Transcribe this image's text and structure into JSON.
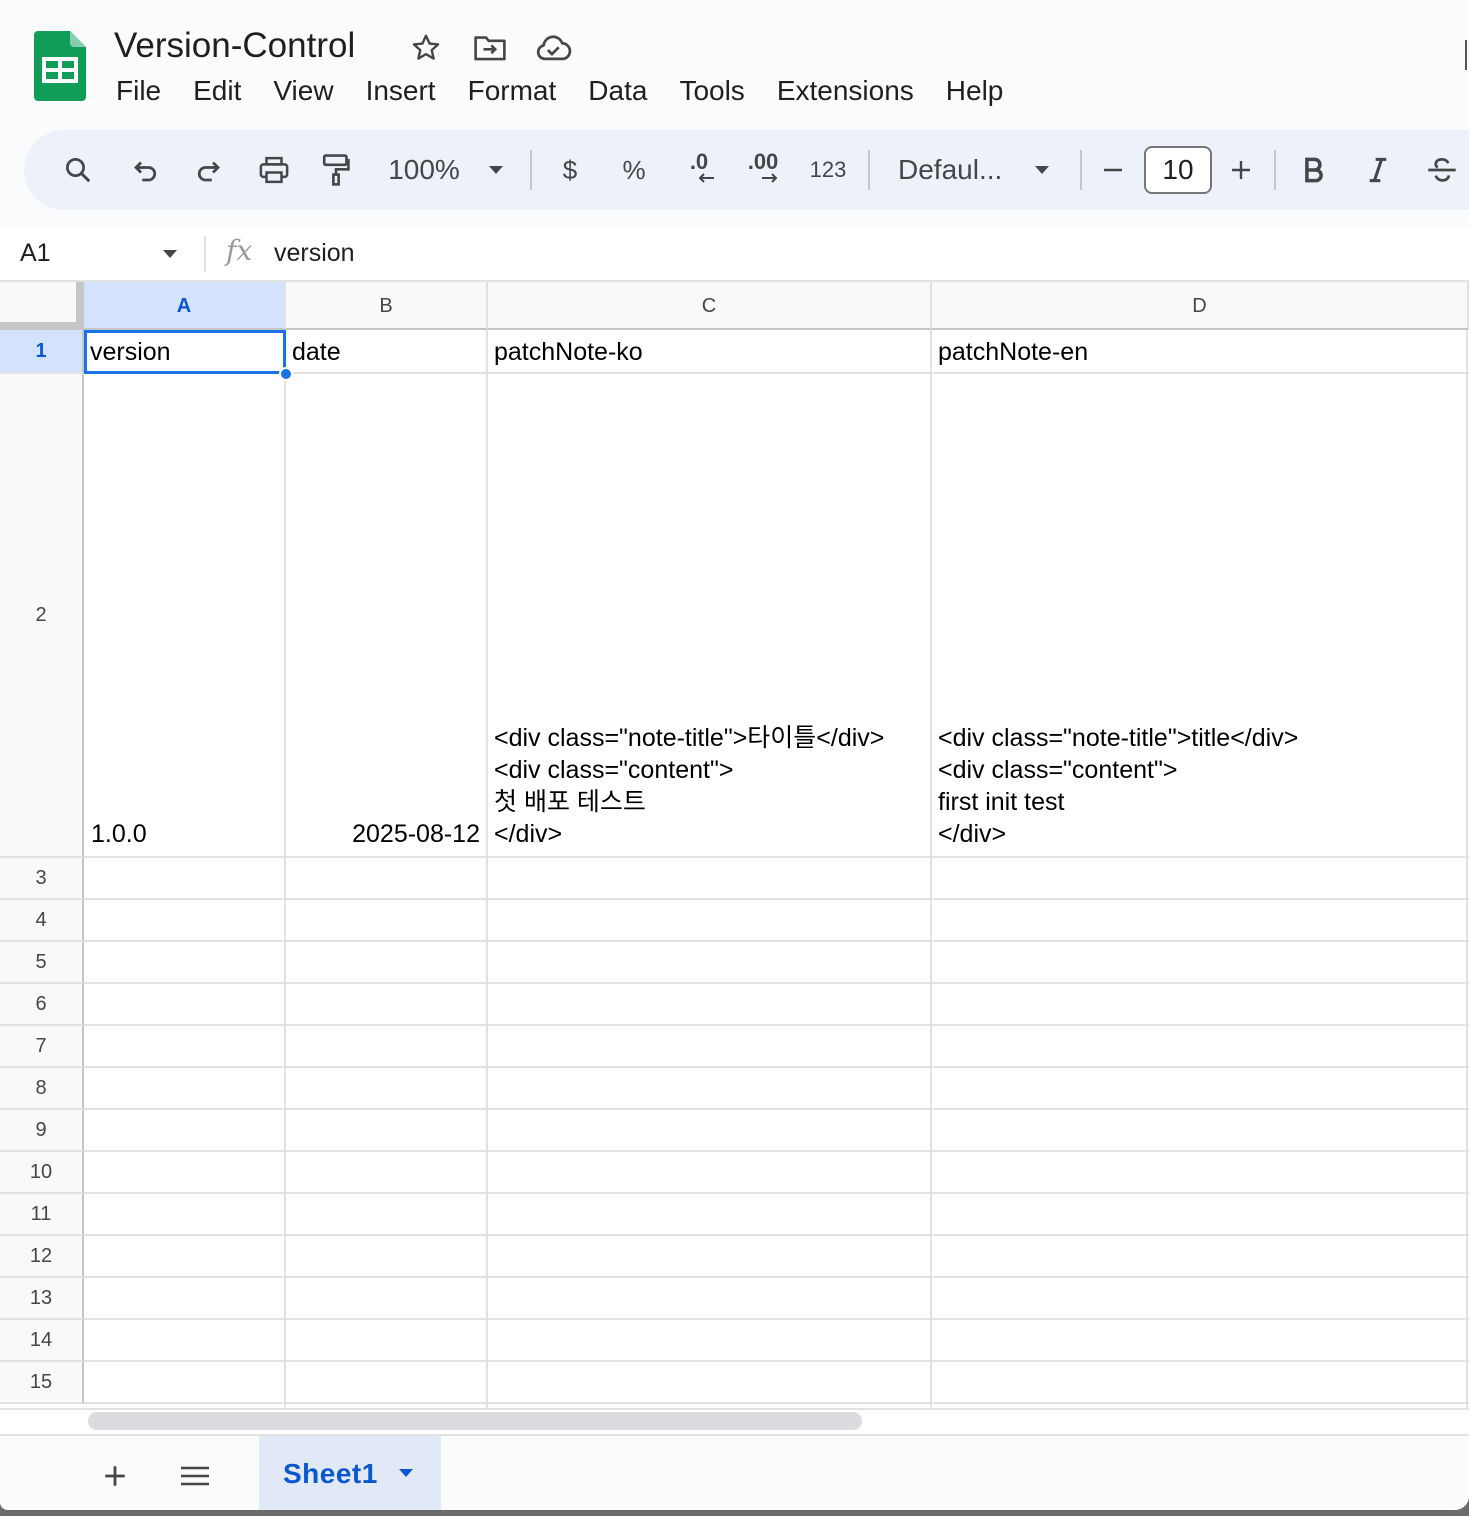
{
  "app": {
    "title": "Version-Control",
    "brand_color": "#0f9d58"
  },
  "menu": [
    "File",
    "Edit",
    "View",
    "Insert",
    "Format",
    "Data",
    "Tools",
    "Extensions",
    "Help"
  ],
  "toolbar": {
    "zoom": "100%",
    "currency": "$",
    "percent": "%",
    "decrease_decimal": ".0",
    "increase_decimal": ".00",
    "number_format": "123",
    "font": "Defaul...",
    "font_size": "10",
    "icons": [
      "search-icon",
      "undo-icon",
      "redo-icon",
      "print-icon",
      "paint-format-icon",
      "zoom-dropdown-icon",
      "font-dropdown-icon",
      "minus-icon",
      "plus-icon",
      "bold-icon",
      "italic-icon",
      "strikethrough-icon"
    ]
  },
  "formula_bar": {
    "name_box": "A1",
    "fx": "fx",
    "value": "version"
  },
  "grid": {
    "columns": [
      "A",
      "B",
      "C",
      "D"
    ],
    "selected_column": "A",
    "rows": [
      "1",
      "2",
      "3",
      "4",
      "5",
      "6",
      "7",
      "8",
      "9",
      "10",
      "11",
      "12",
      "13",
      "14",
      "15"
    ],
    "selected_row": "1",
    "cells": {
      "A1": "version",
      "B1": "date",
      "C1": "patchNote-ko",
      "D1": "patchNote-en",
      "A2": "1.0.0",
      "B2": "2025-08-12",
      "C2": "<div class=\"note-title\">타이틀</div>\n<div class=\"content\">\n첫 배포 테스트\n</div>",
      "D2": "<div class=\"note-title\">title</div>\n<div class=\"content\">\nfirst init test\n</div>"
    },
    "selection_color": "#1a73e8"
  },
  "sheets": {
    "active": "Sheet1",
    "tabs": [
      "Sheet1"
    ]
  }
}
